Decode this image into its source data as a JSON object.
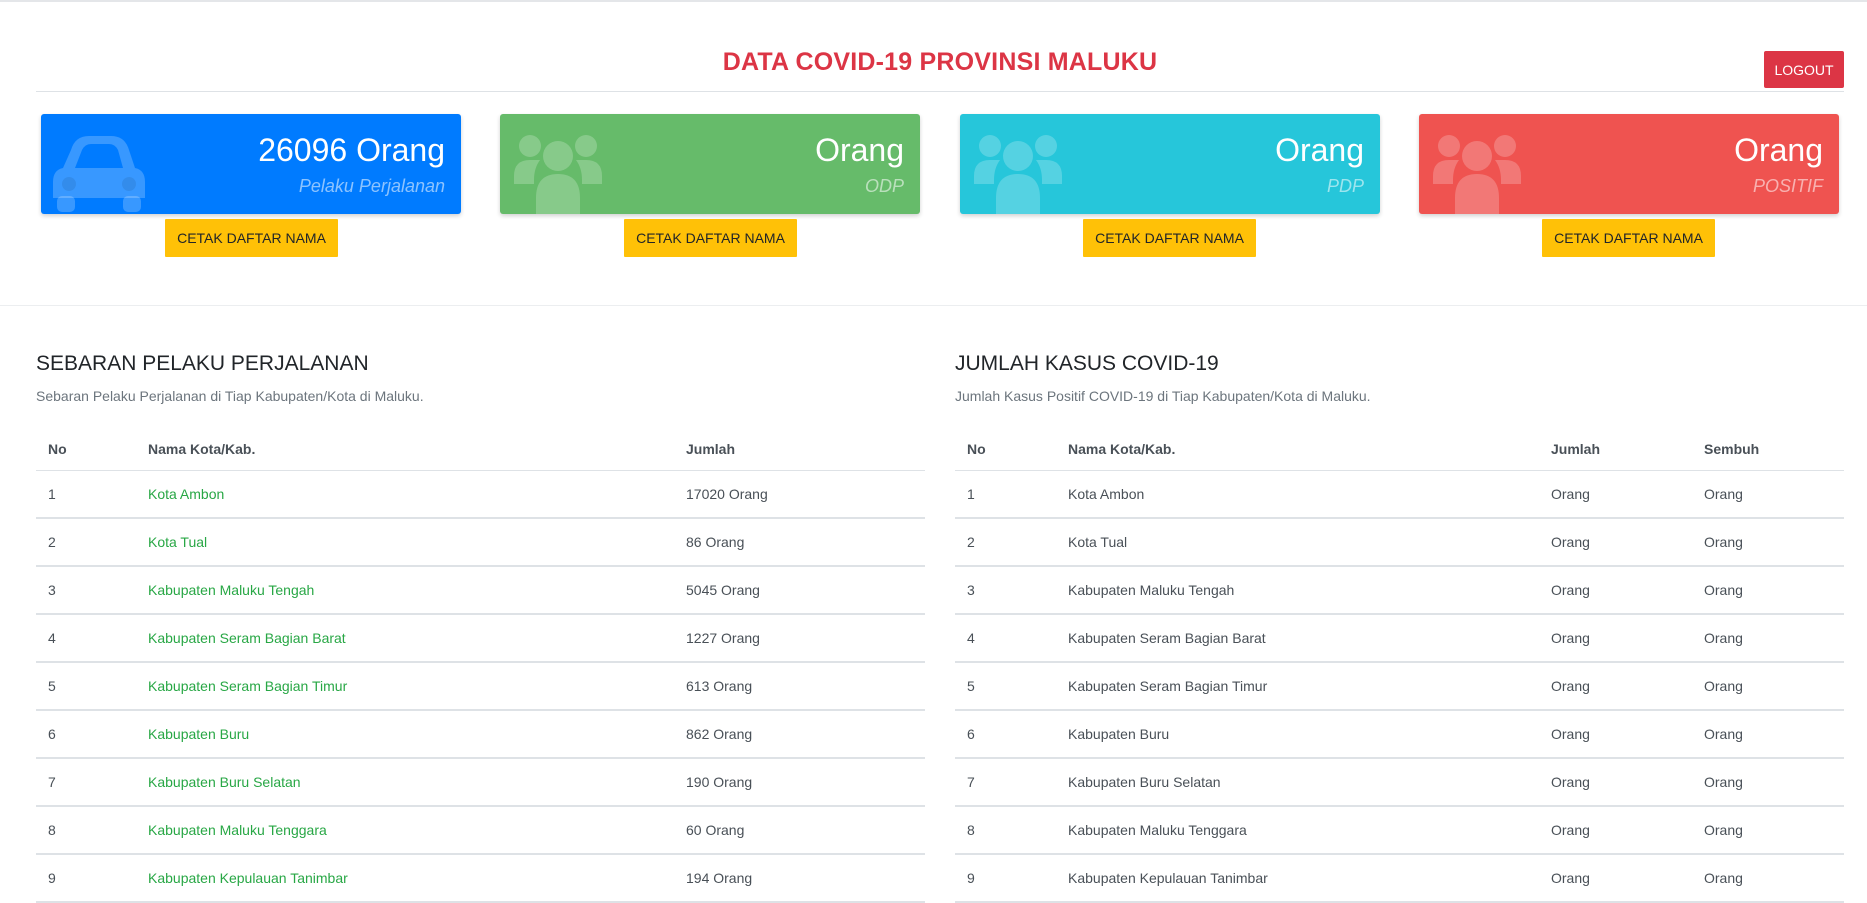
{
  "header": {
    "title": "DATA COVID-19 PROVINSI MALUKU",
    "logout_label": "LOGOUT"
  },
  "cards": [
    {
      "count": "26096 Orang",
      "label": "Pelaku Perjalanan",
      "color": "#007bff",
      "icon": "car-icon",
      "button": "CETAK DAFTAR NAMA"
    },
    {
      "count": "Orang",
      "label": "ODP",
      "color": "#66bb6a",
      "icon": "users-icon",
      "button": "CETAK DAFTAR NAMA"
    },
    {
      "count": "Orang",
      "label": "PDP",
      "color": "#26c6da",
      "icon": "users-icon",
      "button": "CETAK DAFTAR NAMA"
    },
    {
      "count": "Orang",
      "label": "POSITIF",
      "color": "#ef5350",
      "icon": "users-icon",
      "button": "CETAK DAFTAR NAMA"
    }
  ],
  "travelers": {
    "title": "SEBARAN PELAKU PERJALANAN",
    "description": "Sebaran Pelaku Perjalanan di Tiap Kabupaten/Kota di Maluku.",
    "columns": [
      "No",
      "Nama Kota/Kab.",
      "Jumlah"
    ],
    "rows": [
      [
        "1",
        "Kota Ambon",
        "17020 Orang"
      ],
      [
        "2",
        "Kota Tual",
        "86 Orang"
      ],
      [
        "3",
        "Kabupaten Maluku Tengah",
        "5045 Orang"
      ],
      [
        "4",
        "Kabupaten Seram Bagian Barat",
        "1227 Orang"
      ],
      [
        "5",
        "Kabupaten Seram Bagian Timur",
        "613 Orang"
      ],
      [
        "6",
        "Kabupaten Buru",
        "862 Orang"
      ],
      [
        "7",
        "Kabupaten Buru Selatan",
        "190 Orang"
      ],
      [
        "8",
        "Kabupaten Maluku Tenggara",
        "60 Orang"
      ],
      [
        "9",
        "Kabupaten Kepulauan Tanimbar",
        "194 Orang"
      ]
    ]
  },
  "cases": {
    "title": "JUMLAH KASUS COVID-19",
    "description": "Jumlah Kasus Positif COVID-19 di Tiap Kabupaten/Kota di Maluku.",
    "columns": [
      "No",
      "Nama Kota/Kab.",
      "Jumlah",
      "Sembuh"
    ],
    "rows": [
      [
        "1",
        "Kota Ambon",
        "Orang",
        "Orang"
      ],
      [
        "2",
        "Kota Tual",
        "Orang",
        "Orang"
      ],
      [
        "3",
        "Kabupaten Maluku Tengah",
        "Orang",
        "Orang"
      ],
      [
        "4",
        "Kabupaten Seram Bagian Barat",
        "Orang",
        "Orang"
      ],
      [
        "5",
        "Kabupaten Seram Bagian Timur",
        "Orang",
        "Orang"
      ],
      [
        "6",
        "Kabupaten Buru",
        "Orang",
        "Orang"
      ],
      [
        "7",
        "Kabupaten Buru Selatan",
        "Orang",
        "Orang"
      ],
      [
        "8",
        "Kabupaten Maluku Tenggara",
        "Orang",
        "Orang"
      ],
      [
        "9",
        "Kabupaten Kepulauan Tanimbar",
        "Orang",
        "Orang"
      ]
    ]
  }
}
